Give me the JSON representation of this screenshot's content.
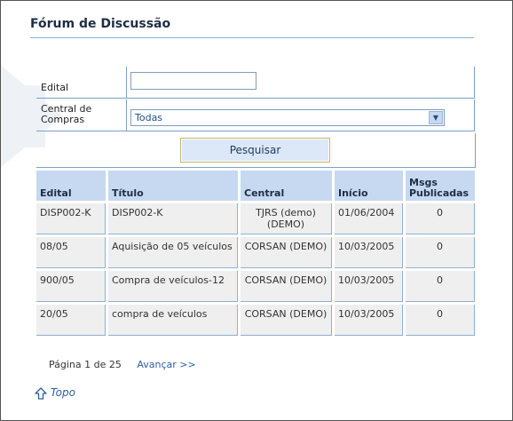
{
  "title": "Fórum de Discussão",
  "form": {
    "edital_label": "Edital",
    "edital_value": "",
    "central_label": "Central de Compras",
    "central_selected": "Todas",
    "search_button": "Pesquisar"
  },
  "table": {
    "headers": [
      "Edital",
      "Título",
      "Central",
      "Início",
      "Msgs Publicadas"
    ],
    "rows": [
      [
        "DISP002-K",
        "DISP002-K",
        "TJRS (demo) (DEMO)",
        "01/06/2004",
        "0"
      ],
      [
        "08/05",
        "Aquisição de 05 veículos",
        "CORSAN (DEMO)",
        "10/03/2005",
        "0"
      ],
      [
        "900/05",
        "Compra de veículos-12",
        "CORSAN (DEMO)",
        "10/03/2005",
        "0"
      ],
      [
        "20/05",
        "compra de veículos",
        "CORSAN (DEMO)",
        "10/03/2005",
        "0"
      ]
    ]
  },
  "pager": {
    "info": "Página 1 de 25",
    "next": "Avançar >>"
  },
  "topo": {
    "label": "Topo",
    "icon": "up-arrow-icon"
  },
  "colors": {
    "header_bg": "#c6d9f1",
    "cell_bg": "#efefef",
    "link": "#2f5f9c"
  }
}
